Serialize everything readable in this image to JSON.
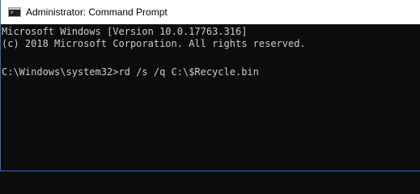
{
  "window": {
    "title": "Administrator: Command Prompt",
    "icon": "command-prompt-icon"
  },
  "console": {
    "lines": [
      "Microsoft Windows [Version 10.0.17763.316]",
      "(c) 2018 Microsoft Corporation. All rights reserved.",
      "",
      "C:\\Windows\\system32>rd /s /q C:\\$Recycle.bin"
    ],
    "text_color": "#cccccc",
    "background_color": "#0c0c0c"
  }
}
